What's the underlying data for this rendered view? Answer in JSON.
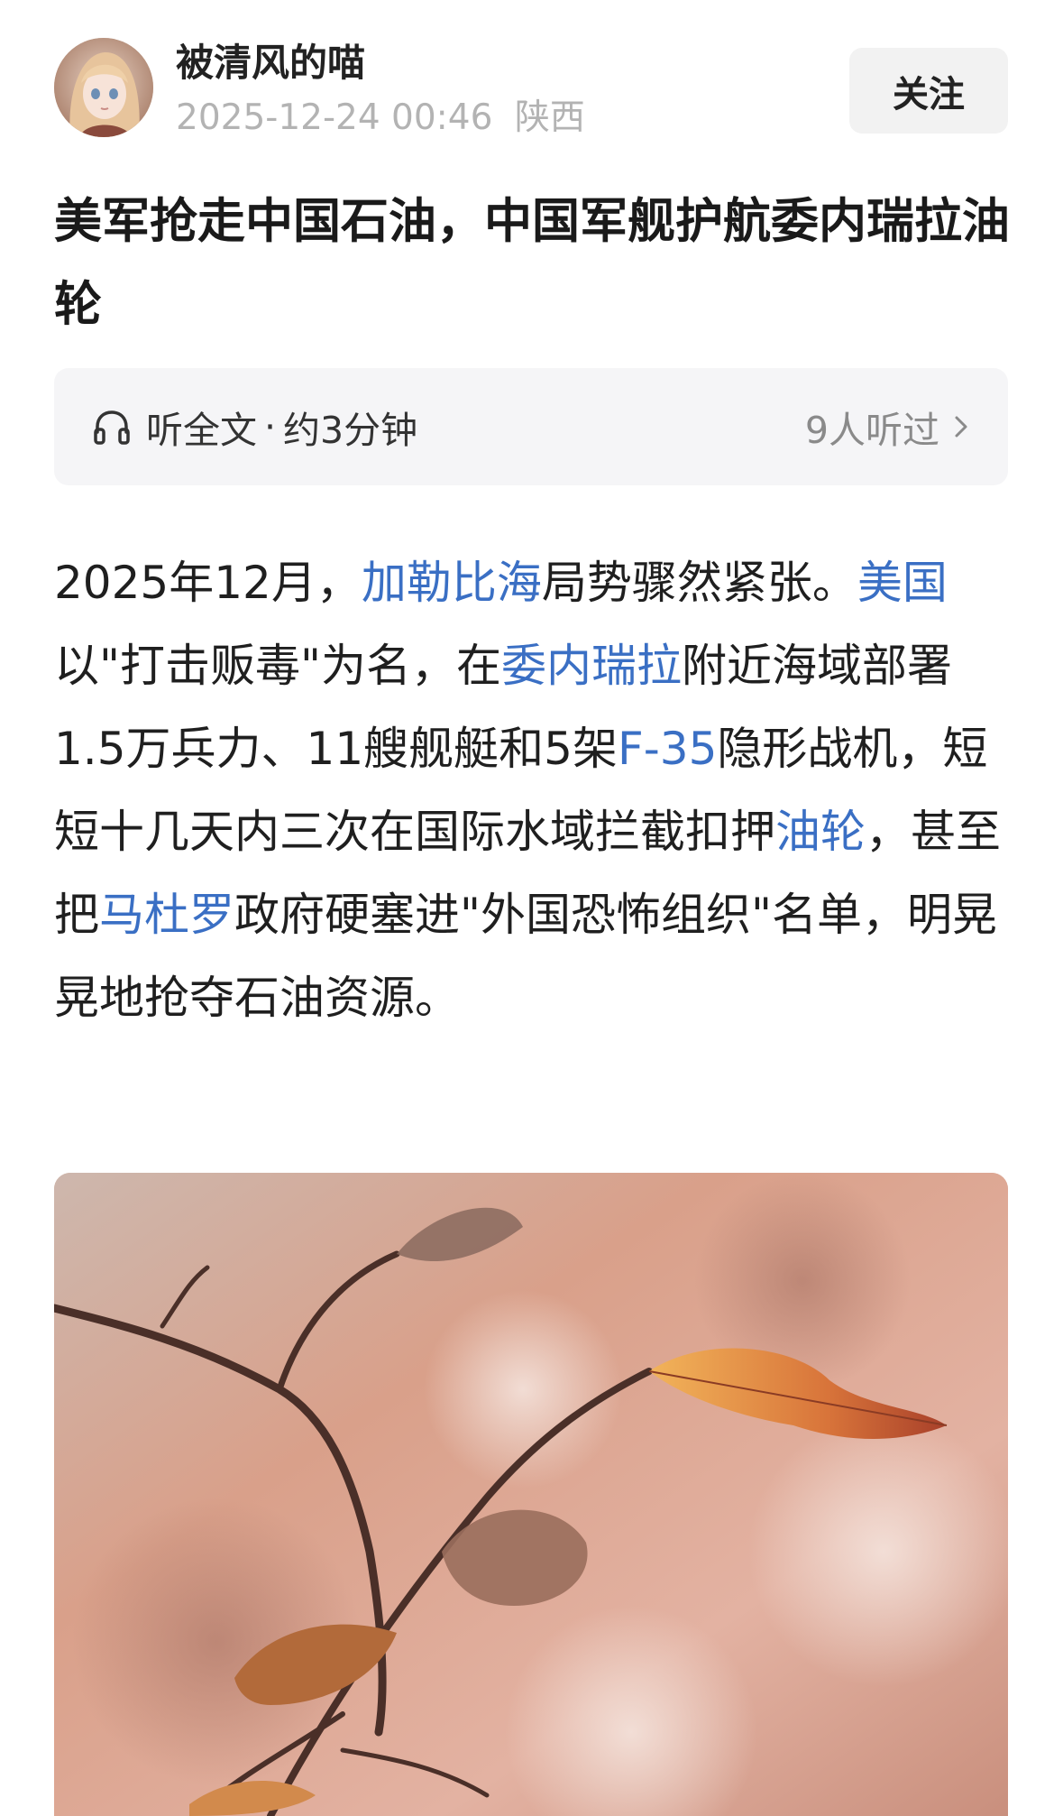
{
  "author": {
    "name": "被清风的喵",
    "timestamp": "2025-12-24 00:46",
    "location": "陕西",
    "avatar_icon": "anime-girl-avatar"
  },
  "follow_button": {
    "label": "关注"
  },
  "article": {
    "title": "美军抢走中国石油，中国军舰护航委内瑞拉油轮",
    "body_segments": [
      {
        "text": "2025年12月，",
        "link": false
      },
      {
        "text": "加勒比海",
        "link": true
      },
      {
        "text": "局势骤然紧张。",
        "link": false
      },
      {
        "text": "美国",
        "link": true
      },
      {
        "text": "以\"打击贩毒\"为名，在",
        "link": false
      },
      {
        "text": "委内瑞拉",
        "link": true
      },
      {
        "text": "附近海域部署1.5万兵力、11艘舰艇和5架",
        "link": false
      },
      {
        "text": "F-35",
        "link": true
      },
      {
        "text": "隐形战机，短短十几天内三次在国际水域拦截扣押",
        "link": false
      },
      {
        "text": "油轮",
        "link": true
      },
      {
        "text": "，甚至把",
        "link": false
      },
      {
        "text": "马杜罗",
        "link": true
      },
      {
        "text": "政府硬塞进\"外国恐怖组织\"名单，明晃晃地抢夺石油资源。",
        "link": false
      }
    ]
  },
  "listen_bar": {
    "icon": "headphone-icon",
    "label": "听全文",
    "separator": "·",
    "duration": "约3分钟",
    "listeners": "9人听过",
    "chevron_icon": "chevron-right-icon"
  },
  "colors": {
    "link": "#3a6fc4",
    "meta": "#b3b3b3",
    "listen_bg": "#f5f5f7",
    "follow_bg": "#f2f2f2"
  },
  "image": {
    "subject": "autumn-branch-with-leaves-photo"
  }
}
